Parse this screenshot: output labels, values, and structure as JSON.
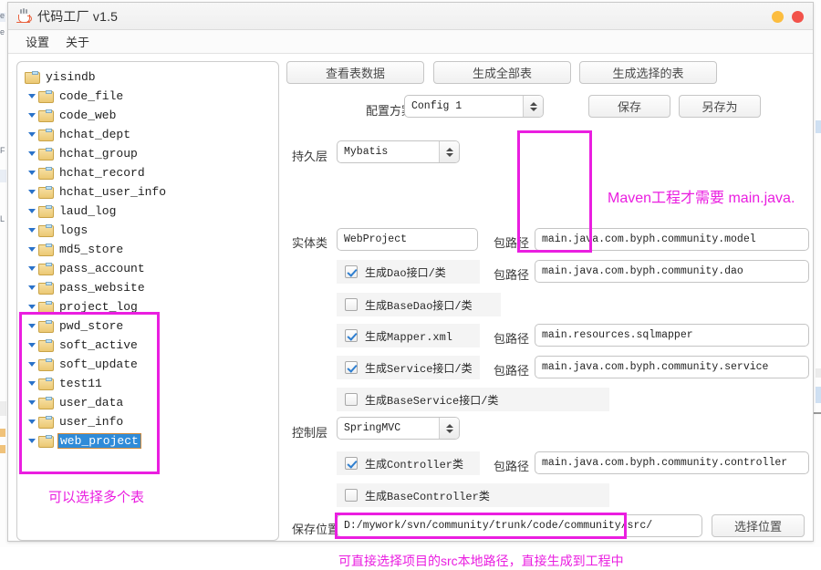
{
  "window": {
    "title": "代码工厂 v1.5",
    "icon": "coffee-cup-icon",
    "minimize_label": "",
    "close_label": ""
  },
  "menu": {
    "items": [
      {
        "label": "设置"
      },
      {
        "label": "关于"
      }
    ]
  },
  "tree": {
    "root": "yisindb",
    "nodes": [
      {
        "label": "code_file",
        "selected": false
      },
      {
        "label": "code_web",
        "selected": false
      },
      {
        "label": "hchat_dept",
        "selected": false
      },
      {
        "label": "hchat_group",
        "selected": false
      },
      {
        "label": "hchat_record",
        "selected": false
      },
      {
        "label": "hchat_user_info",
        "selected": false
      },
      {
        "label": "laud_log",
        "selected": false
      },
      {
        "label": "logs",
        "selected": false
      },
      {
        "label": "md5_store",
        "selected": false
      },
      {
        "label": "pass_account",
        "selected": false
      },
      {
        "label": "pass_website",
        "selected": false
      },
      {
        "label": "project_log",
        "selected": false
      },
      {
        "label": "pwd_store",
        "selected": false
      },
      {
        "label": "soft_active",
        "selected": false
      },
      {
        "label": "soft_update",
        "selected": false
      },
      {
        "label": "test11",
        "selected": false
      },
      {
        "label": "user_data",
        "selected": false
      },
      {
        "label": "user_info",
        "selected": false
      },
      {
        "label": "web_project",
        "selected": true
      }
    ]
  },
  "toolbar": {
    "view_table_data": "查看表数据",
    "generate_all_tables": "生成全部表",
    "generate_selected_tables": "生成选择的表"
  },
  "config_row": {
    "label": "配置方案",
    "selected_scheme": "Config 1",
    "save_label": "保存",
    "save_as_label": "另存为"
  },
  "form": {
    "persistence_layer_label": "持久层",
    "persistence_layer_value": "Mybatis",
    "entity_class_label": "实体类",
    "entity_class_value": "WebProject",
    "package_path_label": "包路径",
    "entity_package": "main.java.com.byph.community.model",
    "dao_package": "main.java.com.byph.community.dao",
    "mapper_package": "main.resources.sqlmapper",
    "service_package": "main.java.com.byph.community.service",
    "controller_package": "main.java.com.byph.community.controller",
    "control_layer_label": "控制层",
    "control_layer_value": "SpringMVC",
    "checkboxes": {
      "gen_dao": {
        "label": "生成Dao接口/类",
        "checked": true
      },
      "gen_base_dao": {
        "label": "生成BaseDao接口/类",
        "checked": false
      },
      "gen_mapper": {
        "label": "生成Mapper.xml",
        "checked": true
      },
      "gen_service": {
        "label": "生成Service接口/类",
        "checked": true
      },
      "gen_base_service": {
        "label": "生成BaseService接口/类",
        "checked": false
      },
      "gen_controller": {
        "label": "生成Controller类",
        "checked": true
      },
      "gen_base_controller": {
        "label": "生成BaseController类",
        "checked": false
      }
    },
    "save_location_label": "保存位置",
    "save_location_value": "D:/mywork/svn/community/trunk/code/community/src/",
    "choose_location_label": "选择位置"
  },
  "annotations": {
    "accent_color": "#ea1ee0",
    "multi_select_note": "可以选择多个表",
    "maven_note": "Maven工程才需要 main.java.",
    "src_path_note": "可直接选择项目的src本地路径，直接生成到工程中"
  }
}
